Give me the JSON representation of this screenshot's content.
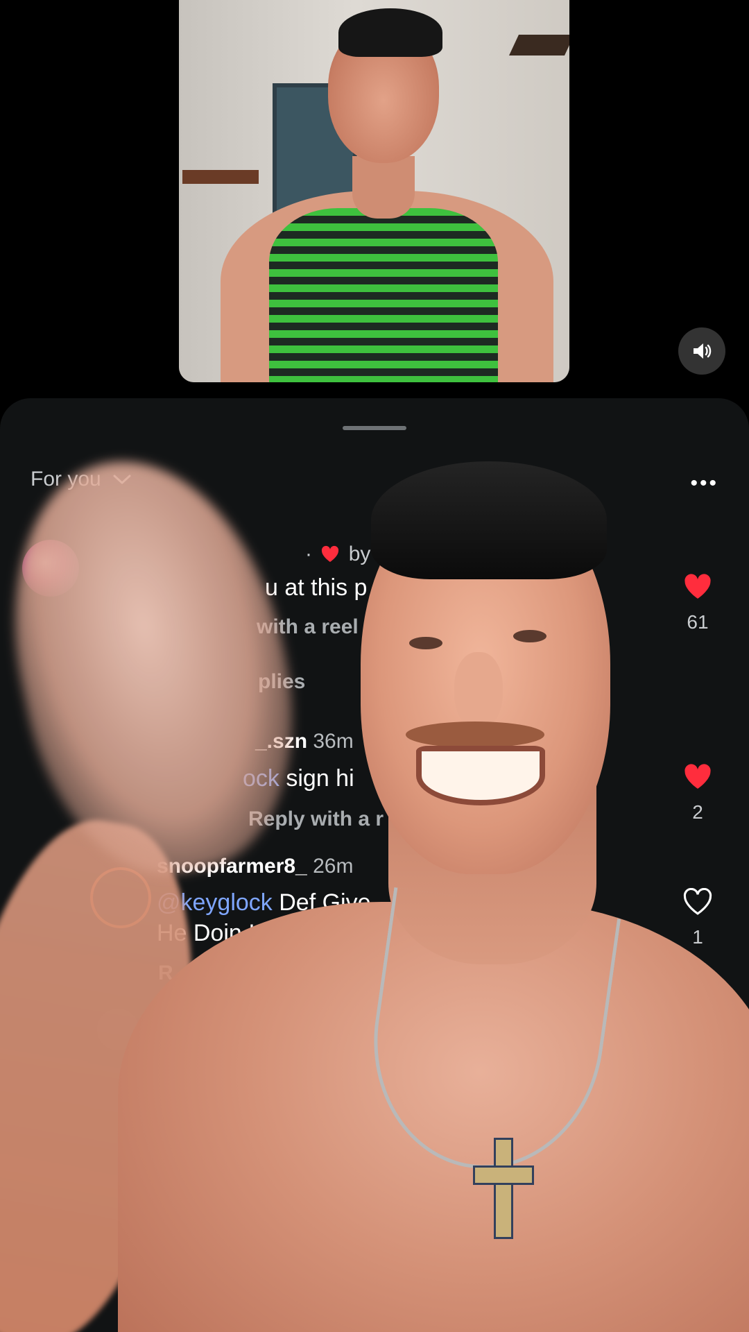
{
  "video": {
    "volume_icon": "speaker-icon"
  },
  "sheet": {
    "feed_selector": "For you",
    "more_icon": "more-horizontal-icon",
    "more_label": "•••"
  },
  "comments": [
    {
      "by_prefix": "·",
      "by_label": "by",
      "text_fragment": "u at this p",
      "reply_fragment": "with a reel",
      "view_replies_fragment": "plies",
      "liked": true,
      "like_count": "61"
    },
    {
      "username_fragment": "_.szn",
      "time": "36m",
      "mention_fragment": "ock",
      "text_fragment": " sign hi",
      "reply_fragment": "Reply with a r",
      "liked": true,
      "like_count": "2"
    },
    {
      "username": "snoopfarmer8_",
      "time": "26m",
      "mention": "@keyglock",
      "text_line1": " Def Give",
      "text_line2": "He Doin It Effort",
      "reply_fragment": "R",
      "liked": false,
      "like_count": "1"
    }
  ],
  "colors": {
    "sheet_bg": "#111314",
    "mention": "#7fa6ff",
    "like_red": "#ff2d3d"
  }
}
